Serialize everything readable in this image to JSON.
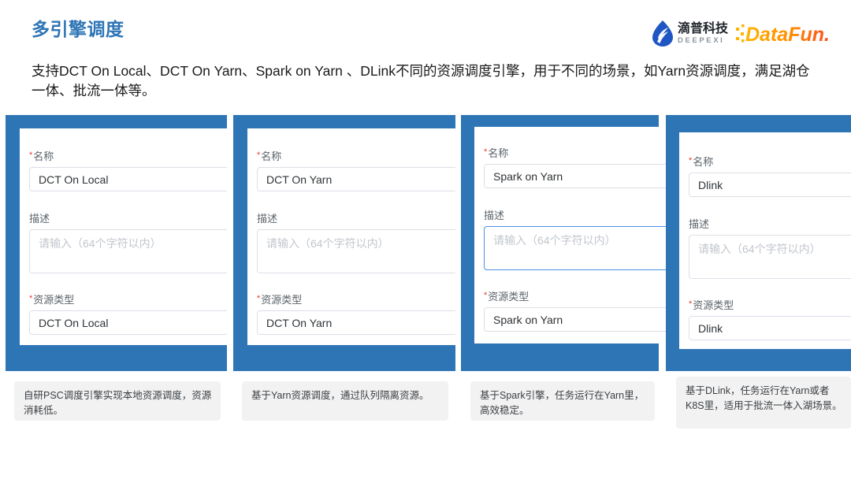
{
  "header": {
    "title": "多引擎调度",
    "intro": "支持DCT On Local、DCT On Yarn、Spark on Yarn 、DLink不同的资源调度引擎，用于不同的场景，如Yarn资源调度，满足湖仓一体、批流一体等。",
    "brand_color": "#2E75B6"
  },
  "logos": {
    "deepexi": {
      "cn": "滴普科技",
      "en": "DEEPEXI",
      "mark": "water-drop-icon",
      "color": "#1f56c4"
    },
    "datafun": {
      "text": "DataFun.",
      "dots": "pixel-dots-icon",
      "color_start": "#FFB400",
      "color_end": "#FF5A1F"
    }
  },
  "labels": {
    "name": "名称",
    "description": "描述",
    "resource_type": "资源类型",
    "required_mark": "*",
    "description_placeholder": "请输入（64个字符以内）"
  },
  "cards": [
    {
      "name_value": "DCT On Local",
      "description_value": "",
      "resource_type_value": "DCT On Local",
      "description_focused": false,
      "caption": "自研PSC调度引擎实现本地资源调度，资源消耗低。"
    },
    {
      "name_value": "DCT On Yarn",
      "description_value": "",
      "resource_type_value": "DCT On Yarn",
      "description_focused": false,
      "caption": "基于Yarn资源调度，通过队列隔离资源。"
    },
    {
      "name_value": "Spark on Yarn",
      "description_value": "",
      "resource_type_value": "Spark on Yarn",
      "description_focused": true,
      "caption": "基于Spark引擎，任务运行在Yarn里，高效稳定。"
    },
    {
      "name_value": "Dlink",
      "description_value": "",
      "resource_type_value": "Dlink",
      "description_focused": false,
      "caption": "基于DLink，任务运行在Yarn或者K8S里，适用于批流一体入湖场景。"
    }
  ]
}
